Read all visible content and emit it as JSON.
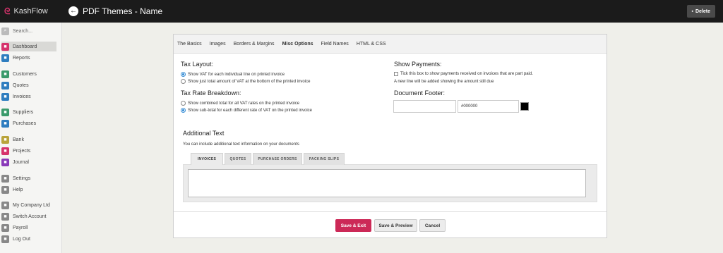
{
  "app": {
    "brand": "KashFlow",
    "title": "PDF Themes - Name",
    "delete_label": "Delete"
  },
  "sidebar": {
    "search_placeholder": "Search...",
    "items": [
      {
        "label": "Dashboard",
        "icon": "dashboard-icon",
        "color": "#d6336c"
      },
      {
        "label": "Reports",
        "icon": "reports-icon",
        "color": "#2e7dbf"
      },
      {
        "label": "Customers",
        "icon": "customers-icon",
        "color": "#3a9a6b"
      },
      {
        "label": "Quotes",
        "icon": "quotes-icon",
        "color": "#2e7dbf"
      },
      {
        "label": "Invoices",
        "icon": "invoices-icon",
        "color": "#2e7dbf"
      },
      {
        "label": "Suppliers",
        "icon": "suppliers-icon",
        "color": "#3a9a6b"
      },
      {
        "label": "Purchases",
        "icon": "purchases-icon",
        "color": "#2e7dbf"
      },
      {
        "label": "Bank",
        "icon": "bank-icon",
        "color": "#b9a43b"
      },
      {
        "label": "Projects",
        "icon": "projects-icon",
        "color": "#d6336c"
      },
      {
        "label": "Journal",
        "icon": "journal-icon",
        "color": "#8a3ab9"
      },
      {
        "label": "Settings",
        "icon": "settings-icon",
        "color": "#888888"
      },
      {
        "label": "Help",
        "icon": "help-icon",
        "color": "#888888"
      },
      {
        "label": "My Company Ltd",
        "icon": "company-icon",
        "color": "#888888"
      },
      {
        "label": "Switch Account",
        "icon": "switch-account-icon",
        "color": "#888888"
      },
      {
        "label": "Payroll",
        "icon": "payroll-icon",
        "color": "#888888"
      },
      {
        "label": "Log Out",
        "icon": "logout-icon",
        "color": "#888888"
      }
    ]
  },
  "tabs": [
    "The Basics",
    "Images",
    "Borders & Margins",
    "Misc Options",
    "Field Names",
    "HTML & CSS"
  ],
  "tax_layout": {
    "title": "Tax Layout:",
    "options": [
      "Show VAT for each individual line on printed invoice",
      "Show just total amount of VAT at the bottom of the printed invoice"
    ]
  },
  "tax_rate": {
    "title": "Tax Rate Breakdown:",
    "options": [
      "Show combined total for all VAT rates on the printed invoice",
      "Show sub-total for each different rate of VAT on the printed invoice"
    ]
  },
  "show_payments": {
    "title": "Show Payments:",
    "checkbox_label": "Tick this box to show payments received on invoices that are part paid.",
    "note": "A new line will be added showing the amount still due"
  },
  "document_footer": {
    "title": "Document Footer:",
    "text_value": "",
    "color_value": "#000000"
  },
  "additional_text": {
    "title": "Additional Text",
    "description": "You can include additional text information on your documents",
    "subtabs": [
      "INVOICES",
      "QUOTES",
      "PURCHASE ORDERS",
      "PACKING SLIPS"
    ]
  },
  "actions": {
    "save_exit": "Save & Exit",
    "save_preview": "Save & Preview",
    "cancel": "Cancel"
  }
}
